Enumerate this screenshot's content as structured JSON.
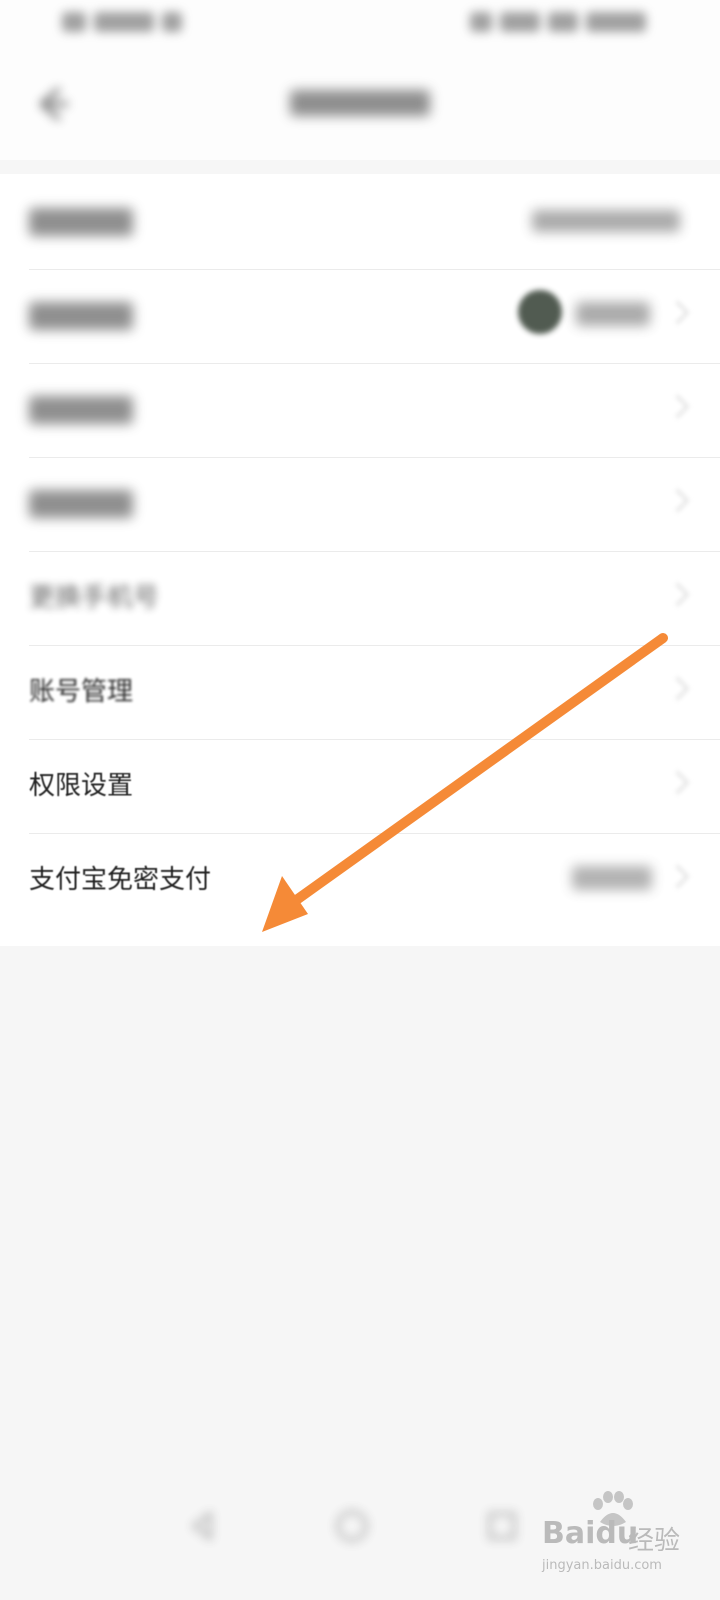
{
  "settings_list": {
    "rows": [
      {
        "label": "",
        "visibility": "hidden"
      },
      {
        "label": "",
        "visibility": "hidden"
      },
      {
        "label": "",
        "visibility": "hidden"
      },
      {
        "label": "",
        "visibility": "hidden"
      },
      {
        "label": "更换手机号",
        "visibility": "blurred"
      },
      {
        "label": "账号管理",
        "visibility": "slightly-blurred"
      },
      {
        "label": "权限设置",
        "visibility": "clear"
      },
      {
        "label": "支付宝免密支付",
        "visibility": "clear"
      }
    ]
  },
  "annotation": {
    "arrow_color": "#f58a37",
    "points_to": "支付宝免密支付"
  },
  "watermark": {
    "brand": "Baidu",
    "sub": "经验",
    "url": "jingyan.baidu.com"
  },
  "colors": {
    "background": "#f6f6f6",
    "card": "#ffffff",
    "text_primary": "#222222",
    "divider": "#ebebeb"
  }
}
